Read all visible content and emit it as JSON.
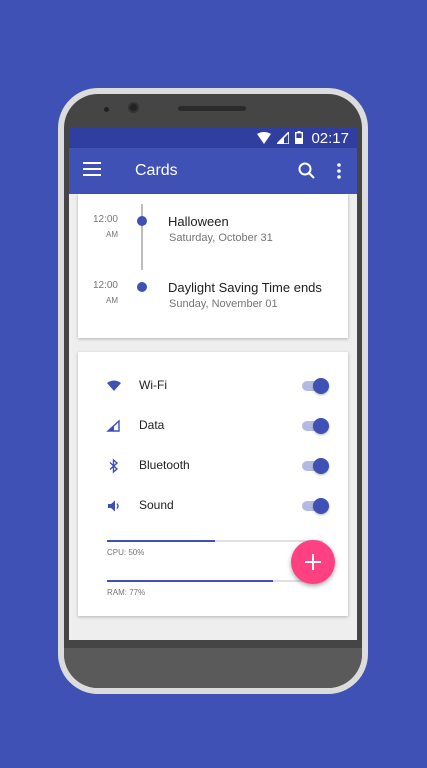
{
  "status_bar": {
    "time": "02:17",
    "icons": [
      "wifi-icon",
      "signal-icon",
      "battery-icon"
    ]
  },
  "app_bar": {
    "title": "Cards",
    "icons": [
      "menu-icon",
      "search-icon",
      "more-vert-icon"
    ]
  },
  "events": [
    {
      "time": "12:00",
      "ampm": "AM",
      "title": "Halloween",
      "date": "Saturday, October 31"
    },
    {
      "time": "12:00",
      "ampm": "AM",
      "title": "Daylight Saving Time ends",
      "date": "Sunday, November 01"
    }
  ],
  "toggles": [
    {
      "label": "Wi-Fi",
      "icon": "wifi-icon",
      "on": true
    },
    {
      "label": "Data",
      "icon": "signal-icon",
      "on": true
    },
    {
      "label": "Bluetooth",
      "icon": "bluetooth-icon",
      "on": true
    },
    {
      "label": "Sound",
      "icon": "volume-icon",
      "on": true
    }
  ],
  "meters": [
    {
      "label": "CPU: 50%",
      "value": 0.5
    },
    {
      "label": "RAM: 77%",
      "value": 0.77
    }
  ],
  "fab": {
    "icon": "add-icon"
  },
  "colors": {
    "primary": "#3f51b5",
    "primary_dark": "#303f9f",
    "accent": "#ff4081",
    "background": "#3f51b5"
  }
}
